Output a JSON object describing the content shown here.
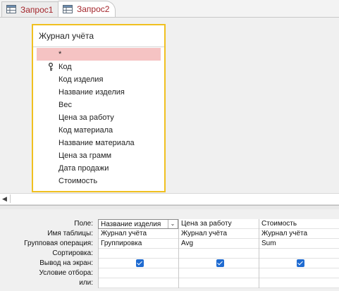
{
  "tabs": [
    {
      "label": "Запрос1",
      "active": false,
      "icon": "query-icon"
    },
    {
      "label": "Запрос2",
      "active": true,
      "icon": "query-icon"
    }
  ],
  "field_list": {
    "title": "Журнал учёта",
    "items": [
      {
        "label": "*",
        "selected": true,
        "key": false
      },
      {
        "label": "Код",
        "selected": false,
        "key": true
      },
      {
        "label": "Код изделия",
        "selected": false,
        "key": false
      },
      {
        "label": "Название изделия",
        "selected": false,
        "key": false
      },
      {
        "label": "Вес",
        "selected": false,
        "key": false
      },
      {
        "label": "Цена за работу",
        "selected": false,
        "key": false
      },
      {
        "label": "Код материала",
        "selected": false,
        "key": false
      },
      {
        "label": "Название материала",
        "selected": false,
        "key": false
      },
      {
        "label": "Цена за грамм",
        "selected": false,
        "key": false
      },
      {
        "label": "Дата продажи",
        "selected": false,
        "key": false
      },
      {
        "label": "Стоимость",
        "selected": false,
        "key": false
      }
    ],
    "border_color": "#f0c020",
    "selection_color": "#f5c3c3"
  },
  "grid": {
    "row_labels": [
      "Поле:",
      "Имя таблицы:",
      "Групповая операция:",
      "Сортировка:",
      "Вывод на экран:",
      "Условие отбора:",
      "или:"
    ],
    "columns": [
      {
        "field": "Название изделия",
        "table": "Журнал учёта",
        "group": "Группировка",
        "sort": "",
        "show": true,
        "criteria": "",
        "or": ""
      },
      {
        "field": "Цена за работу",
        "table": "Журнал учёта",
        "group": "Avg",
        "sort": "",
        "show": true,
        "criteria": "",
        "or": ""
      },
      {
        "field": "Стоимость",
        "table": "Журнал учёта",
        "group": "Sum",
        "sort": "",
        "show": true,
        "criteria": "",
        "or": ""
      }
    ],
    "checkbox_color": "#1f6bd1"
  },
  "colors": {
    "tab_text": "#a4262c",
    "background": "#f0f0f0"
  }
}
